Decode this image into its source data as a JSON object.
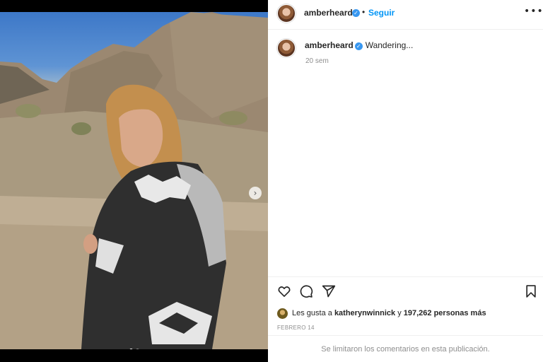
{
  "post": {
    "username": "amberheard",
    "follow_label": "Seguir",
    "separator": "•",
    "more_icon": "more-options-icon",
    "caption": {
      "username": "amberheard",
      "text": "Wandering..."
    },
    "time_ago": "20 sem",
    "media": {
      "next_icon": "chevron-right-icon",
      "carousel_dots": 2,
      "active_dot": 1
    },
    "actions": {
      "like_icon": "heart-icon",
      "comment_icon": "comment-icon",
      "share_icon": "share-icon",
      "save_icon": "bookmark-icon"
    },
    "likes": {
      "prefix": "Les gusta a",
      "first_user": "katherynwinnick",
      "joiner": "y",
      "count_text": "197,262 personas más"
    },
    "date": "FEBRERO 14",
    "comments_limited": "Se limitaron los comentarios en esta publicación."
  },
  "colors": {
    "accent": "#0095f6",
    "verified": "#3897f0",
    "muted": "#8e8e8e",
    "text": "#262626"
  }
}
